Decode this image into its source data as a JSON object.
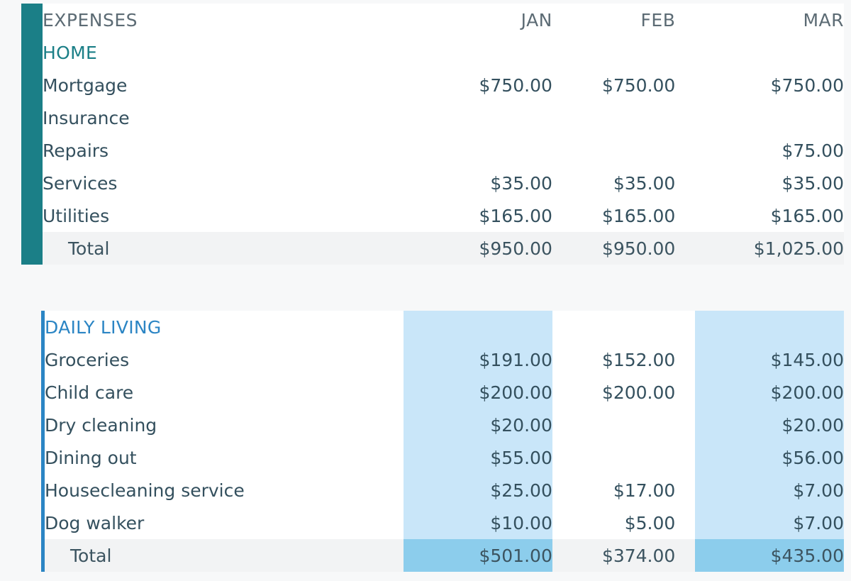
{
  "table": {
    "header": {
      "label": "EXPENSES",
      "months": [
        "JAN",
        "FEB",
        "MAR"
      ]
    },
    "colors": {
      "home_accent": "#1b7f87",
      "daily_accent": "#2b85c4",
      "highlight_light": "#c9e6f9",
      "highlight_strong": "#8ccdec",
      "total_row_bg": "#f2f3f4",
      "text": "#34505e",
      "page_bg": "#f7f8f9"
    },
    "sections": [
      {
        "title": "HOME",
        "accent": "#1b7f87",
        "highlighted_columns": [],
        "rows": [
          {
            "label": "Mortgage",
            "values": [
              "$750.00",
              "$750.00",
              "$750.00"
            ]
          },
          {
            "label": "Insurance",
            "values": [
              "",
              "",
              ""
            ]
          },
          {
            "label": "Repairs",
            "values": [
              "",
              "",
              "$75.00"
            ]
          },
          {
            "label": "Services",
            "values": [
              "$35.00",
              "$35.00",
              "$35.00"
            ]
          },
          {
            "label": "Utilities",
            "values": [
              "$165.00",
              "$165.00",
              "$165.00"
            ]
          }
        ],
        "total": {
          "label": "Total",
          "values": [
            "$950.00",
            "$950.00",
            "$1,025.00"
          ]
        }
      },
      {
        "title": "DAILY LIVING",
        "accent": "#2b85c4",
        "highlighted_columns": [
          0,
          2
        ],
        "rows": [
          {
            "label": "Groceries",
            "values": [
              "$191.00",
              "$152.00",
              "$145.00"
            ]
          },
          {
            "label": "Child care",
            "values": [
              "$200.00",
              "$200.00",
              "$200.00"
            ]
          },
          {
            "label": "Dry cleaning",
            "values": [
              "$20.00",
              "",
              "$20.00"
            ]
          },
          {
            "label": "Dining out",
            "values": [
              "$55.00",
              "",
              "$56.00"
            ]
          },
          {
            "label": "Housecleaning service",
            "values": [
              "$25.00",
              "$17.00",
              "$7.00"
            ]
          },
          {
            "label": "Dog walker",
            "values": [
              "$10.00",
              "$5.00",
              "$7.00"
            ]
          }
        ],
        "total": {
          "label": "Total",
          "values": [
            "$501.00",
            "$374.00",
            "$435.00"
          ]
        }
      }
    ]
  }
}
